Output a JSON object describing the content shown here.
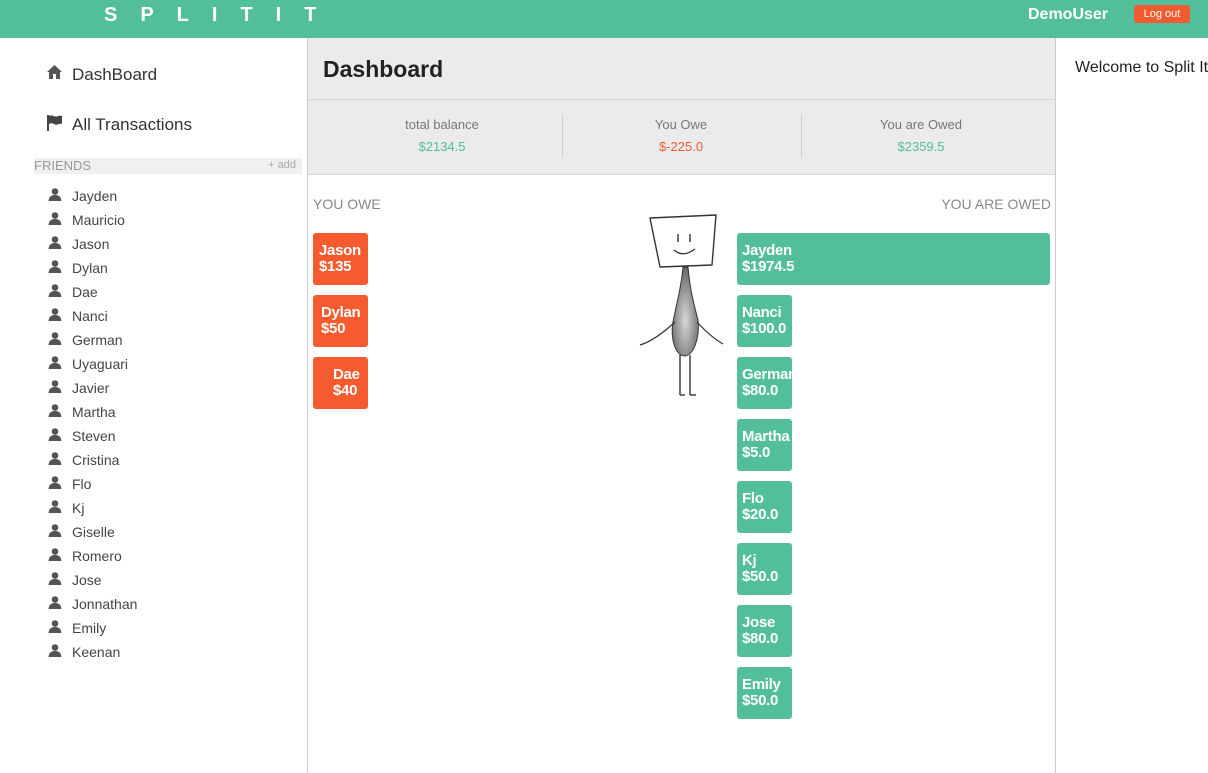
{
  "app": {
    "brand": "SPLITIT",
    "username": "DemoUser",
    "logout_label": "Log out"
  },
  "sidebar": {
    "nav": [
      {
        "label": "DashBoard",
        "icon": "home-icon"
      },
      {
        "label": "All Transactions",
        "icon": "flag-icon"
      }
    ],
    "friends_title": "FRIENDS",
    "add_label": "+ add",
    "friends": [
      "Jayden",
      "Mauricio",
      "Jason",
      "Dylan",
      "Dae",
      "Nanci",
      "German",
      "Uyaguari",
      "Javier",
      "Martha",
      "Steven",
      "Cristina",
      "Flo",
      "Kj",
      "Giselle",
      "Romero",
      "Jose",
      "Jonnathan",
      "Emily",
      "Keenan"
    ]
  },
  "main": {
    "title": "Dashboard",
    "summary": [
      {
        "label": "total balance",
        "value": "$2134.5",
        "color": "#52bf9a"
      },
      {
        "label": "You Owe",
        "value": "$-225.0",
        "color": "#f25a30"
      },
      {
        "label": "You are Owed",
        "value": "$2359.5",
        "color": "#52bf9a"
      }
    ],
    "you_owe_title": "YOU OWE",
    "you_are_owed_title": "YOU ARE OWED",
    "you_owe": [
      {
        "name": "Jason",
        "amount": "$135"
      },
      {
        "name": "Dylan",
        "amount": "$50"
      },
      {
        "name": "Dae",
        "amount": "$40"
      }
    ],
    "you_are_owed": [
      {
        "name": "Jayden",
        "amount": "$1974.5"
      },
      {
        "name": "Nanci",
        "amount": "$100.0"
      },
      {
        "name": "German",
        "amount": "$80.0"
      },
      {
        "name": "Martha",
        "amount": "$5.0"
      },
      {
        "name": "Flo",
        "amount": "$20.0"
      },
      {
        "name": "Kj",
        "amount": "$50.0"
      },
      {
        "name": "Jose",
        "amount": "$80.0"
      },
      {
        "name": "Emily",
        "amount": "$50.0"
      }
    ]
  },
  "right_panel": {
    "welcome": "Welcome to Split It"
  },
  "colors": {
    "brand_green": "#52bf9a",
    "accent_orange": "#f25a30"
  }
}
